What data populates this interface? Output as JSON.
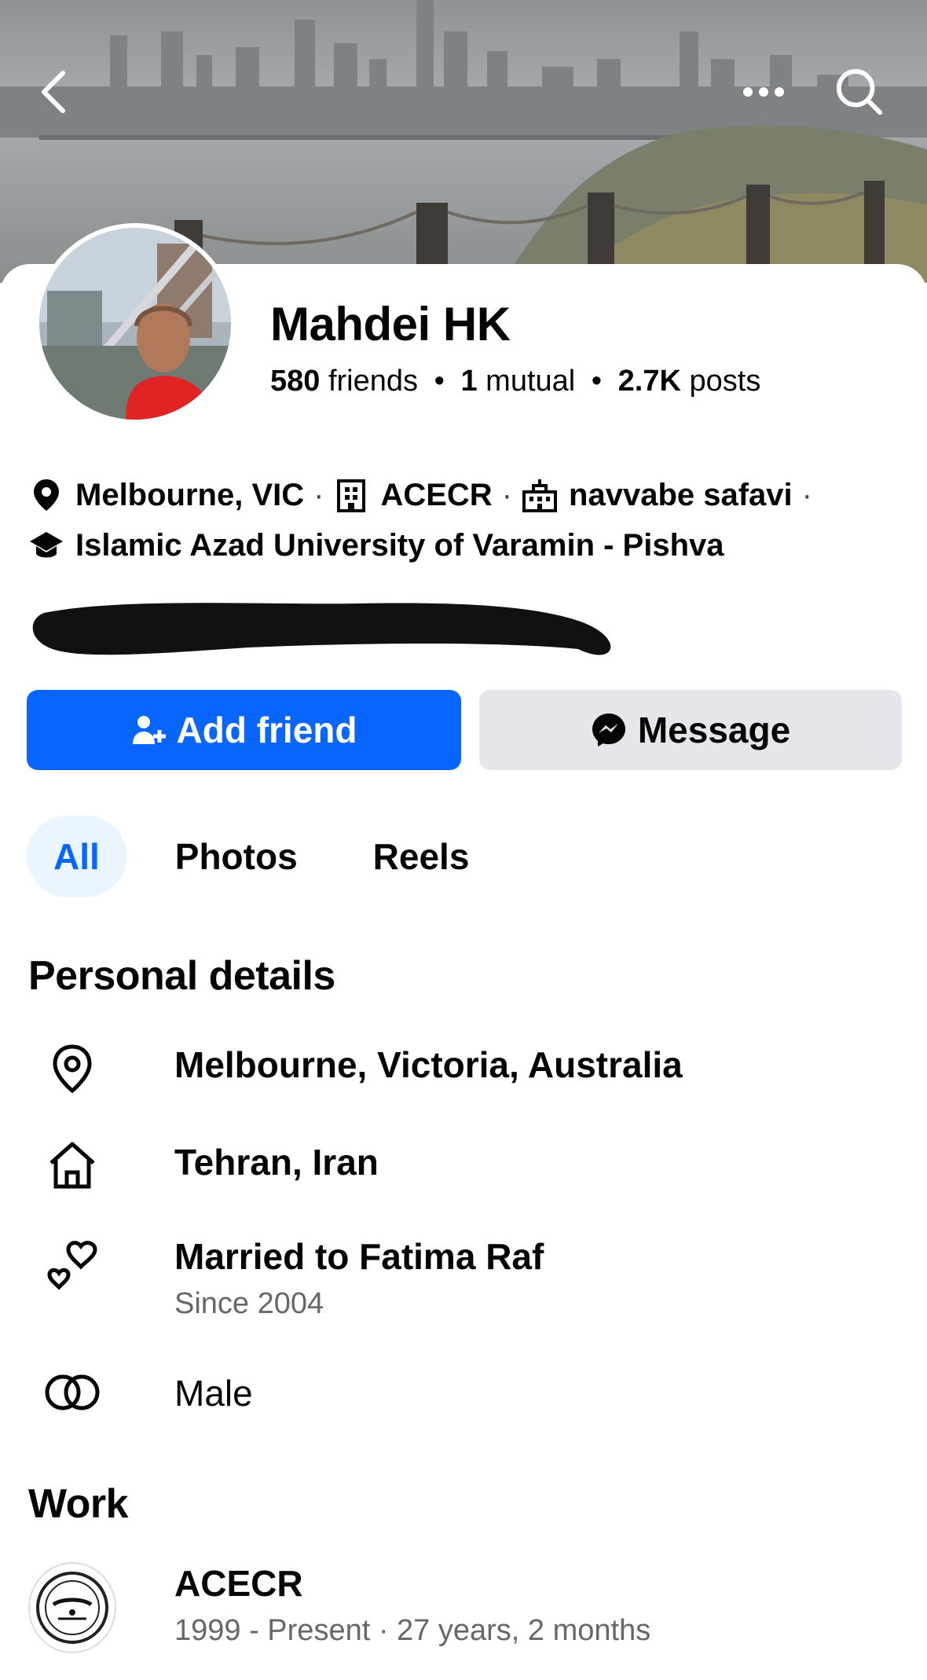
{
  "header": {
    "back_icon": "chevron-left-icon",
    "more_icon": "more-horizontal-icon",
    "search_icon": "search-icon"
  },
  "profile": {
    "name": "Mahdei HK",
    "friends_count": "580",
    "friends_label": "friends",
    "mutual_count": "1",
    "mutual_label": "mutual",
    "posts_count": "2.7K",
    "posts_label": "posts"
  },
  "intro": {
    "location": "Melbourne, VIC",
    "workplace": "ACECR",
    "school": "navvabe safavi",
    "university": "Islamic Azad University of Varamin - Pishva"
  },
  "actions": {
    "add_friend": "Add friend",
    "message": "Message"
  },
  "tabs": [
    {
      "label": "All",
      "active": true
    },
    {
      "label": "Photos",
      "active": false
    },
    {
      "label": "Reels",
      "active": false
    }
  ],
  "personal_details": {
    "title": "Personal details",
    "lives_in": "Melbourne, Victoria, Australia",
    "from": "Tehran, Iran",
    "relationship": "Married to Fatima Raf",
    "relationship_since": "Since 2004",
    "gender": "Male"
  },
  "work": {
    "title": "Work",
    "employer": "ACECR",
    "duration": "1999 - Present · 27 years, 2 months"
  },
  "colors": {
    "primary": "#0866ff",
    "secondary_button": "#e4e6eb",
    "active_tab_bg": "#ebf5ff",
    "muted_text": "#65676b"
  }
}
